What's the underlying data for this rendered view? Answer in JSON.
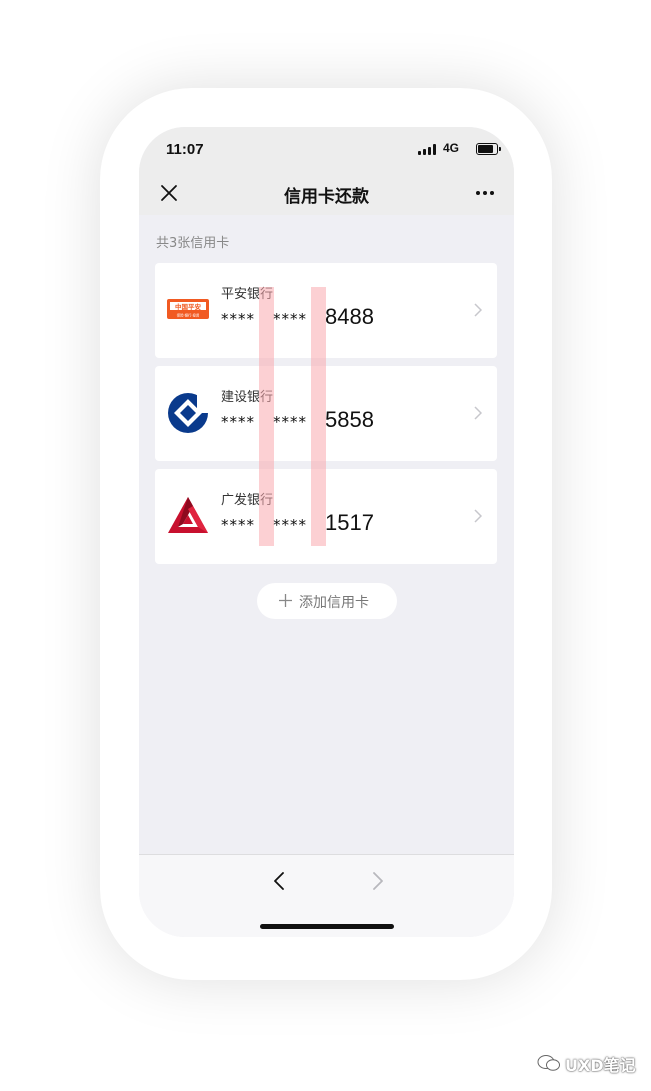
{
  "status_bar": {
    "time": "11:07",
    "network": "4G"
  },
  "nav": {
    "title": "信用卡还款"
  },
  "summary": {
    "count_label": "共3张信用卡"
  },
  "cards": [
    {
      "bank": "平安银行",
      "mask1": "****",
      "mask2": "****",
      "last4": "8488",
      "logo": "pingan-logo",
      "logo_text": "中国平安",
      "logo_subtext": "保险·银行·投资"
    },
    {
      "bank": "建设银行",
      "mask1": "****",
      "mask2": "****",
      "last4": "5858",
      "logo": "ccb-logo"
    },
    {
      "bank": "广发银行",
      "mask1": "****",
      "mask2": "****",
      "last4": "1517",
      "logo": "cgb-logo"
    }
  ],
  "add_card": {
    "label": "添加信用卡"
  },
  "watermark": {
    "text": "UXD笔记"
  },
  "colors": {
    "page_bg": "#efeff4",
    "nav_bg": "#ededed",
    "card_bg": "#ffffff",
    "pingan_orange": "#f15a22",
    "ccb_blue": "#0a3a8c",
    "cgb_red": "#c8102e",
    "guide_pink": "#fab0b4"
  }
}
